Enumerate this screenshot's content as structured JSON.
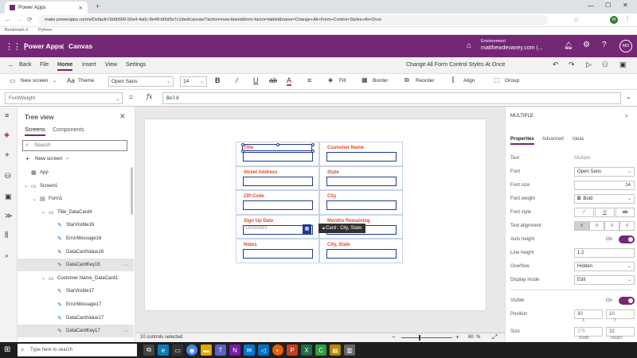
{
  "browser": {
    "tab_title": "Power Apps",
    "url": "make.powerapps.com/e/Default-f1b6b509-50a4-4a0c-8e48-bf3d3e7c1ded/canvas/?action=new-blank&form-factor=tablet&name=Change+All+Form+Control+Styles+At+Once",
    "bookmarks": [
      "Bookmark it",
      "Python"
    ]
  },
  "header": {
    "app_name": "Power Apps",
    "separator": "|",
    "section": "Canvas",
    "environment_label": "Environment",
    "environment_value": "matthewdevaney.com (...",
    "avatar_initials": "MD"
  },
  "menu": {
    "back": "Back",
    "items": [
      "File",
      "Home",
      "Insert",
      "View",
      "Settings"
    ],
    "active": "Home",
    "app_title": "Change All Form Control Styles At Once"
  },
  "ribbon": {
    "new_screen": "New screen",
    "theme": "Theme",
    "font": "Open Sans",
    "font_size": "14",
    "fill": "Fill",
    "border": "Border",
    "reorder": "Reorder",
    "align": "Align",
    "group": "Group"
  },
  "formula": {
    "property": "FontWeight",
    "eq": "=",
    "fx": "fx",
    "value": "Bold"
  },
  "tree": {
    "title": "Tree view",
    "tabs": [
      "Screens",
      "Components"
    ],
    "search_placeholder": "Search",
    "new_screen": "New screen",
    "items": [
      {
        "label": "App",
        "indent": 0,
        "icon": "app-icon",
        "selected": false
      },
      {
        "label": "Screen1",
        "indent": 0,
        "icon": "screen-icon",
        "selected": false
      },
      {
        "label": "Form1",
        "indent": 1,
        "icon": "form-icon",
        "selected": false
      },
      {
        "label": "Title_DataCard4",
        "indent": 2,
        "icon": "card-icon",
        "selected": false
      },
      {
        "label": "StarVisible16",
        "indent": 3,
        "icon": "edit-icon",
        "selected": false
      },
      {
        "label": "ErrorMessage16",
        "indent": 3,
        "icon": "edit-icon",
        "selected": false
      },
      {
        "label": "DataCardValue16",
        "indent": 3,
        "icon": "edit-icon",
        "selected": false
      },
      {
        "label": "DataCardKey16",
        "indent": 3,
        "icon": "edit-icon",
        "selected": true
      },
      {
        "label": "Customer Name_DataCard1",
        "indent": 2,
        "icon": "card-icon",
        "selected": false
      },
      {
        "label": "StarVisible17",
        "indent": 3,
        "icon": "edit-icon",
        "selected": false
      },
      {
        "label": "ErrorMessage17",
        "indent": 3,
        "icon": "edit-icon",
        "selected": false
      },
      {
        "label": "DataCardValue17",
        "indent": 3,
        "icon": "edit-icon",
        "selected": false
      },
      {
        "label": "DataCardKey17",
        "indent": 3,
        "icon": "edit-icon",
        "selected": true
      }
    ]
  },
  "canvas": {
    "cards": [
      {
        "label": "Title",
        "col": 0,
        "row": 0
      },
      {
        "label": "Customer Name",
        "col": 1,
        "row": 0
      },
      {
        "label": "Street Address",
        "col": 0,
        "row": 1
      },
      {
        "label": "State",
        "col": 1,
        "row": 1
      },
      {
        "label": "ZIP Code",
        "col": 0,
        "row": 2
      },
      {
        "label": "City",
        "col": 1,
        "row": 2
      },
      {
        "label": "Sign Up Date",
        "col": 0,
        "row": 3
      },
      {
        "label": "Months Remaining",
        "col": 1,
        "row": 3
      },
      {
        "label": "Notes",
        "col": 0,
        "row": 4
      },
      {
        "label": "City, State",
        "col": 1,
        "row": 4
      }
    ],
    "date_placeholder": "12/31/2001",
    "tooltip": "Card : City, State",
    "status": "10 controls selected",
    "zoom": "60",
    "zoom_unit": "%"
  },
  "props": {
    "header": "MULTIPLE",
    "tabs": [
      "Properties",
      "Advanced",
      "Ideas"
    ],
    "rows": {
      "text_label": "Text",
      "text_value": "Multiple",
      "font_label": "Font",
      "font_value": "Open Sans",
      "font_size_label": "Font size",
      "font_size_value": "14",
      "font_weight_label": "Font weight",
      "font_weight_value": "Bold",
      "font_style_label": "Font style",
      "text_align_label": "Text alignment",
      "auto_height_label": "Auto height",
      "auto_height_value": "On",
      "line_height_label": "Line height",
      "line_height_value": "1.2",
      "overflow_label": "Overflow",
      "overflow_value": "Hidden",
      "display_mode_label": "Display mode",
      "display_mode_value": "Edit",
      "visible_label": "Visible",
      "visible_value": "On",
      "position_label": "Position",
      "pos_x": "30",
      "pos_y": "10",
      "x_caption": "X",
      "y_caption": "Y",
      "size_label": "Size",
      "width": "275",
      "height": "32",
      "w_caption": "Width",
      "h_caption": "Height"
    }
  },
  "taskbar": {
    "search_placeholder": "Type here to search"
  },
  "colors": {
    "brand": "#742774",
    "card_label": "#e84a27",
    "input_border": "#1f3a93",
    "toggle_on": "#742774"
  }
}
